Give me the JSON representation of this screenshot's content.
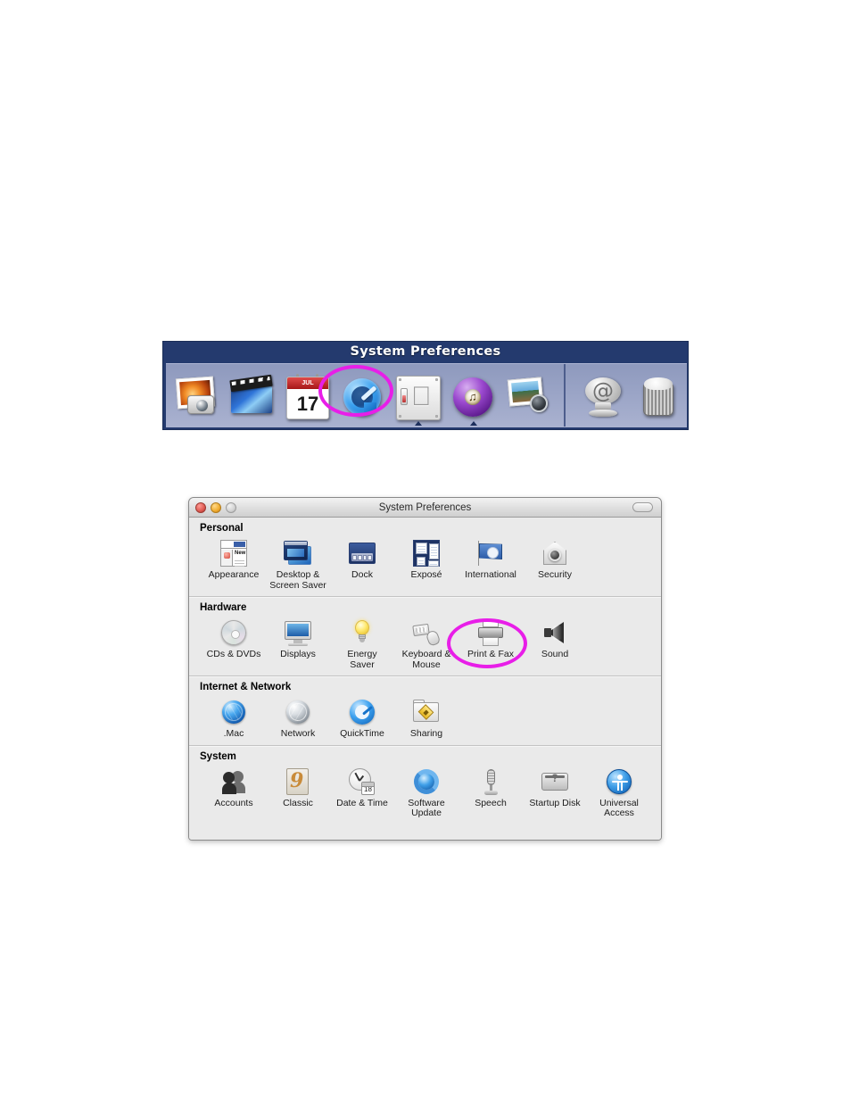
{
  "dock": {
    "title": "System Preferences",
    "items": [
      {
        "label": "iPhoto",
        "icon": "iphoto-icon",
        "running": false
      },
      {
        "label": "iMovie",
        "icon": "imovie-icon",
        "running": false
      },
      {
        "label": "iCal",
        "icon": "ical-icon",
        "running": false,
        "calendar_month": "JUL",
        "calendar_day": "17"
      },
      {
        "label": "QuickTime Player",
        "icon": "quicktime-icon",
        "running": false
      },
      {
        "label": "System Preferences",
        "icon": "system-preferences-icon",
        "running": true
      },
      {
        "label": "iTunes",
        "icon": "itunes-icon",
        "running": true
      },
      {
        "label": "Image Capture",
        "icon": "image-capture-icon",
        "running": false
      }
    ],
    "right_items": [
      {
        "label": "Mail",
        "icon": "at-sign-icon"
      },
      {
        "label": "Trash",
        "icon": "trash-icon"
      }
    ]
  },
  "window": {
    "title": "System Preferences",
    "controls": {
      "close_label": "Close",
      "minimize_label": "Minimize",
      "zoom_label": "Zoom",
      "toolbar_toggle_label": "Show/Hide Toolbar"
    },
    "sections": [
      {
        "heading": "Personal",
        "items": [
          {
            "label": "Appearance",
            "icon": "appearance-icon"
          },
          {
            "label": "Desktop &\nScreen Saver",
            "icon": "desktop-screensaver-icon"
          },
          {
            "label": "Dock",
            "icon": "dock-icon"
          },
          {
            "label": "Exposé",
            "icon": "expose-icon"
          },
          {
            "label": "International",
            "icon": "international-icon"
          },
          {
            "label": "Security",
            "icon": "security-icon"
          }
        ]
      },
      {
        "heading": "Hardware",
        "items": [
          {
            "label": "CDs & DVDs",
            "icon": "cds-dvds-icon"
          },
          {
            "label": "Displays",
            "icon": "displays-icon"
          },
          {
            "label": "Energy\nSaver",
            "icon": "energy-saver-icon"
          },
          {
            "label": "Keyboard &\nMouse",
            "icon": "keyboard-mouse-icon"
          },
          {
            "label": "Print & Fax",
            "icon": "print-fax-icon",
            "highlighted": true
          },
          {
            "label": "Sound",
            "icon": "sound-icon"
          }
        ]
      },
      {
        "heading": "Internet & Network",
        "items": [
          {
            "label": ".Mac",
            "icon": "dot-mac-icon"
          },
          {
            "label": "Network",
            "icon": "network-icon"
          },
          {
            "label": "QuickTime",
            "icon": "quicktime-pref-icon"
          },
          {
            "label": "Sharing",
            "icon": "sharing-icon"
          }
        ]
      },
      {
        "heading": "System",
        "items": [
          {
            "label": "Accounts",
            "icon": "accounts-icon"
          },
          {
            "label": "Classic",
            "icon": "classic-icon",
            "badge": "9"
          },
          {
            "label": "Date & Time",
            "icon": "date-time-icon",
            "calendar_day": "18"
          },
          {
            "label": "Software\nUpdate",
            "icon": "software-update-icon"
          },
          {
            "label": "Speech",
            "icon": "speech-icon"
          },
          {
            "label": "Startup Disk",
            "icon": "startup-disk-icon",
            "badge": "?"
          },
          {
            "label": "Universal\nAccess",
            "icon": "universal-access-icon"
          }
        ]
      }
    ]
  },
  "annotations": {
    "accent_color": "#e81ee8",
    "callouts": [
      {
        "target": "dock-quicktime-item",
        "shape": "ellipse"
      },
      {
        "target": "pref-item-print-fax",
        "shape": "ellipse"
      }
    ]
  }
}
